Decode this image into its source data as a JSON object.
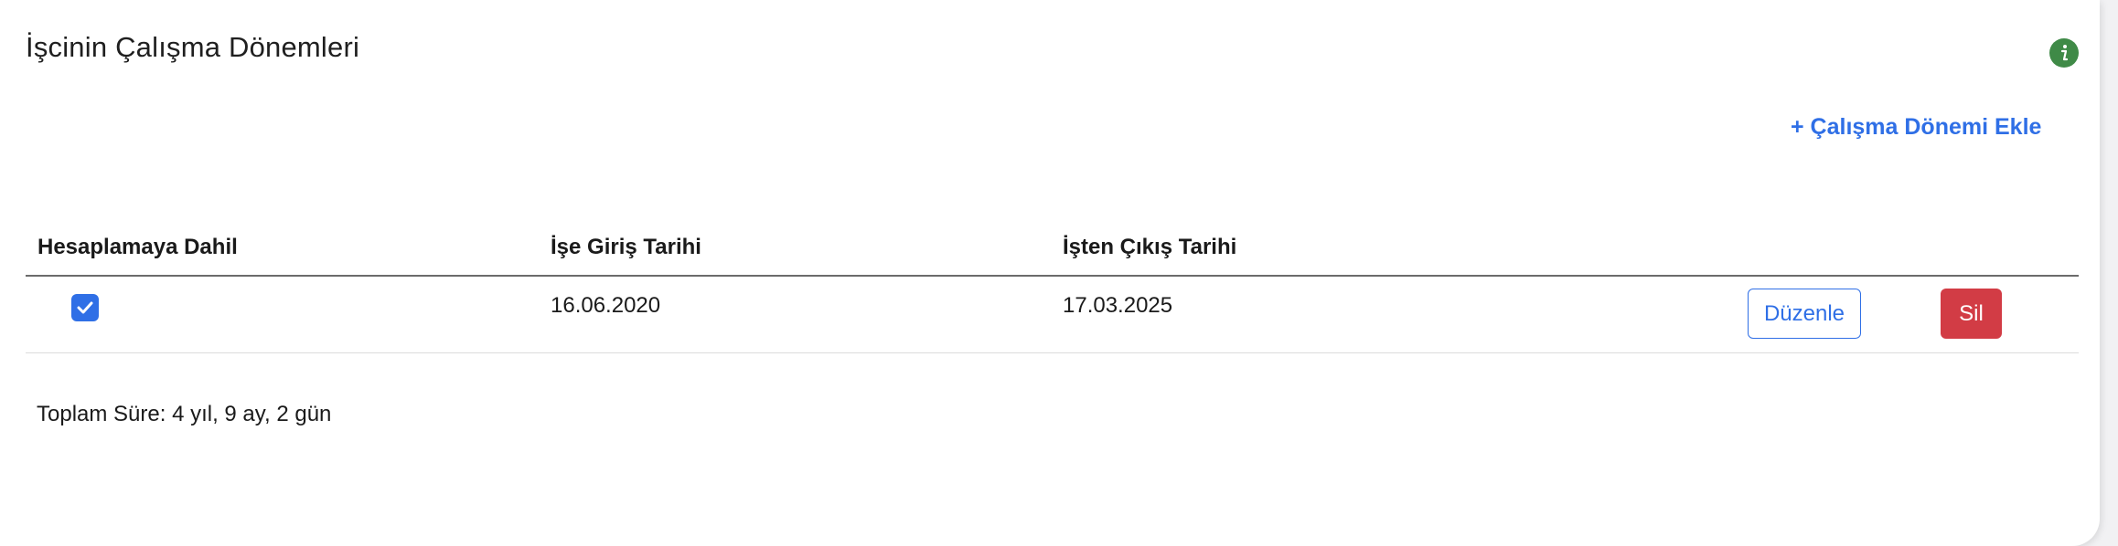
{
  "card": {
    "title": "İşcinin Çalışma Dönemleri",
    "info_icon": "info-icon",
    "add_link_label": "+ Çalışma Dönemi Ekle"
  },
  "table": {
    "headers": [
      "Hesaplamaya Dahil",
      "İşe Giriş Tarihi",
      "İşten Çıkış Tarihi"
    ],
    "rows": [
      {
        "included": true,
        "start_date": "16.06.2020",
        "end_date": "17.03.2025",
        "edit_label": "Düzenle",
        "delete_label": "Sil"
      }
    ]
  },
  "summary": {
    "total_text": "Toplam Süre: 4 yıl, 9 ay, 2 gün"
  },
  "colors": {
    "accent": "#2f6fe6",
    "danger": "#d23c45",
    "info": "#3f8a47"
  }
}
